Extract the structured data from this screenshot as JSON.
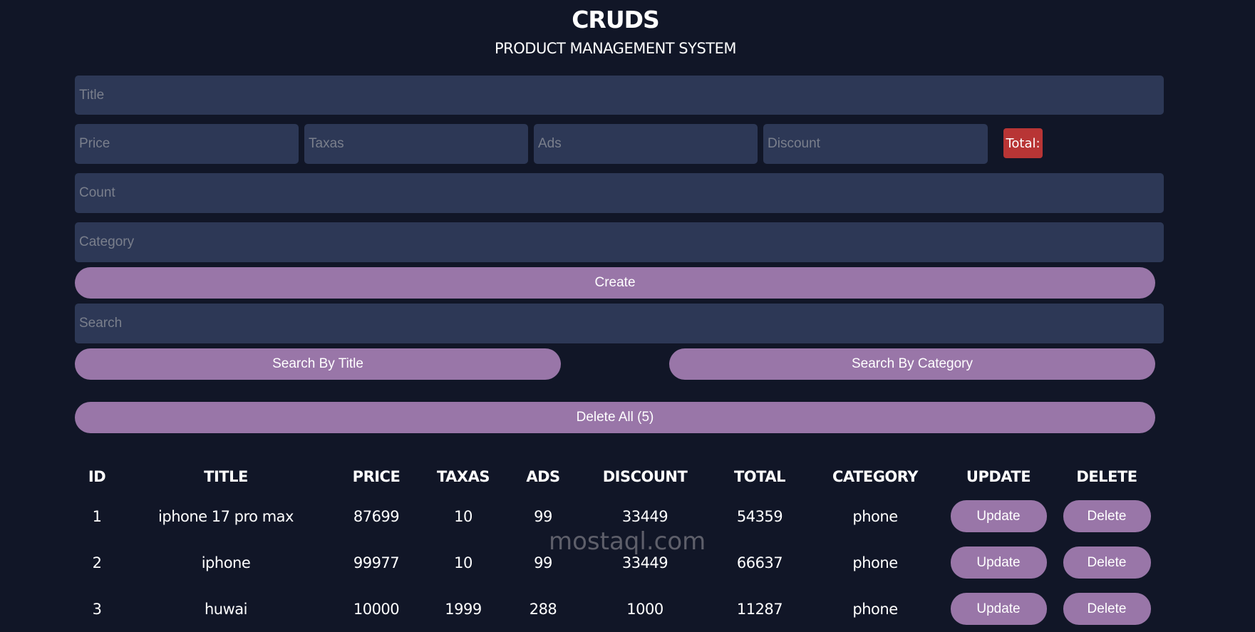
{
  "header": {
    "title": "CRUDS",
    "subtitle": "PRODUCT MANAGEMENT SYSTEM"
  },
  "form": {
    "title_placeholder": "Title",
    "price_placeholder": "Price",
    "taxas_placeholder": "Taxas",
    "ads_placeholder": "Ads",
    "discount_placeholder": "Discount",
    "total_label": "Total:",
    "count_placeholder": "Count",
    "category_placeholder": "Category",
    "create_label": "Create",
    "search_placeholder": "Search",
    "search_title_label": "Search By Title",
    "search_category_label": "Search By Category",
    "delete_all_label": "Delete All (5)"
  },
  "table": {
    "headers": [
      "ID",
      "TITLE",
      "PRICE",
      "TAXAS",
      "ADS",
      "DISCOUNT",
      "TOTAL",
      "CATEGORY",
      "UPDATE",
      "DELETE"
    ],
    "update_label": "Update",
    "delete_label": "Delete",
    "rows": [
      {
        "id": "1",
        "title": "iphone 17 pro max",
        "price": "87699",
        "taxas": "10",
        "ads": "99",
        "discount": "33449",
        "total": "54359",
        "category": "phone"
      },
      {
        "id": "2",
        "title": "iphone",
        "price": "99977",
        "taxas": "10",
        "ads": "99",
        "discount": "33449",
        "total": "66637",
        "category": "phone"
      },
      {
        "id": "3",
        "title": "huwai",
        "price": "10000",
        "taxas": "1999",
        "ads": "288",
        "discount": "1000",
        "total": "11287",
        "category": "phone"
      }
    ]
  },
  "watermark": "mostaql.com",
  "colors": {
    "background": "#111627",
    "input": "#2d3856",
    "button": "#9976a8",
    "total_badge": "#b83535"
  }
}
